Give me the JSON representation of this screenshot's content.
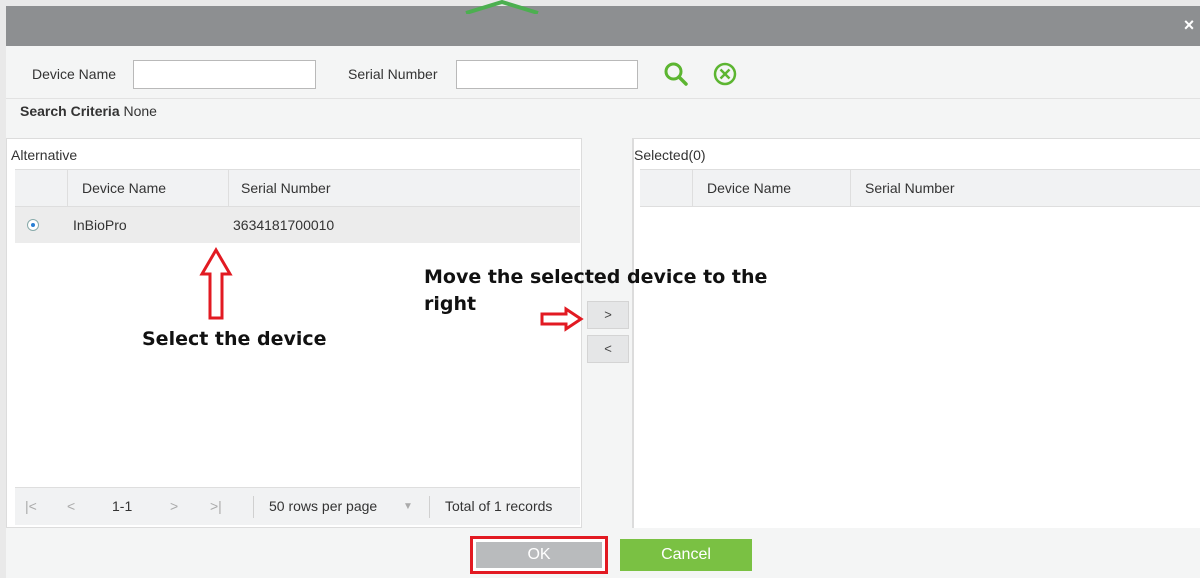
{
  "dialog": {
    "close_glyph": "×"
  },
  "search": {
    "device_name_label": "Device Name",
    "device_name_value": "",
    "serial_number_label": "Serial Number",
    "serial_number_value": "",
    "search_icon": "search-icon",
    "clear_icon": "clear-circle-icon"
  },
  "criteria": {
    "label": "Search Criteria",
    "value": "None"
  },
  "alternative": {
    "title": "Alternative",
    "columns": [
      "Device Name",
      "Serial Number"
    ],
    "rows": [
      {
        "selected": true,
        "device_name": "InBioPro",
        "serial_number": "3634181700010"
      }
    ],
    "pager": {
      "first": "|<",
      "prev": "<",
      "range": "1-1",
      "next": ">",
      "last": ">|",
      "rows_per_page": "50 rows per page",
      "total": "Total of 1 records"
    }
  },
  "move_buttons": {
    "right": ">",
    "left": "<"
  },
  "selected": {
    "title": "Selected(0)",
    "columns": [
      "Device Name",
      "Serial Number"
    ]
  },
  "annotations": {
    "select_device": "Select the device",
    "move_right": "Move the selected device to the right"
  },
  "footer": {
    "ok_label": "OK",
    "cancel_label": "Cancel"
  },
  "colors": {
    "accent_green": "#7ac143",
    "annotation_red": "#e21a22",
    "titlebar": "#8d8f91",
    "ok_disabled": "#b9bbbd"
  }
}
